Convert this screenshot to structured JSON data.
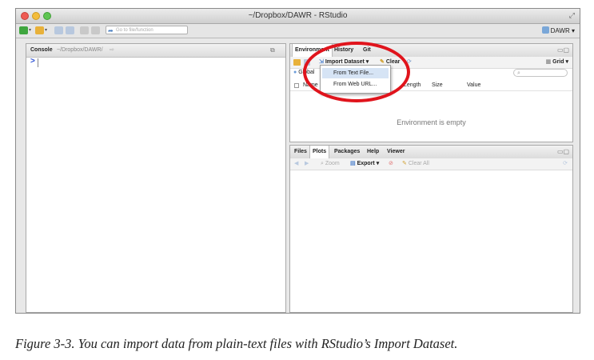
{
  "window": {
    "title": "~/Dropbox/DAWR - RStudio",
    "goto_placeholder": "Go to file/function",
    "project_label": "DAWR"
  },
  "console": {
    "label": "Console",
    "path": "~/Dropbox/DAWR/",
    "prompt": ">"
  },
  "environment_pane": {
    "tabs": [
      "Environment",
      "History",
      "Git"
    ],
    "import_dataset_label": "Import Dataset",
    "clear_label": "Clear",
    "grid_label": "Grid",
    "scope_label": "Global",
    "columns": [
      "Name",
      "Length",
      "Size",
      "Value"
    ],
    "empty_message": "Environment is empty"
  },
  "import_menu": {
    "items": [
      "From Text File...",
      "From Web URL..."
    ]
  },
  "files_pane": {
    "tabs": [
      "Files",
      "Plots",
      "Packages",
      "Help",
      "Viewer"
    ],
    "zoom_label": "Zoom",
    "export_label": "Export",
    "clear_all_label": "Clear All"
  },
  "caption": "Figure 3-3. You can import data from plain-text files with RStudio’s Import Dataset.",
  "colors": {
    "highlight_ring": "#e0141c",
    "prompt": "#2a4fd6",
    "menu_highlight": "#d6e4f5"
  }
}
